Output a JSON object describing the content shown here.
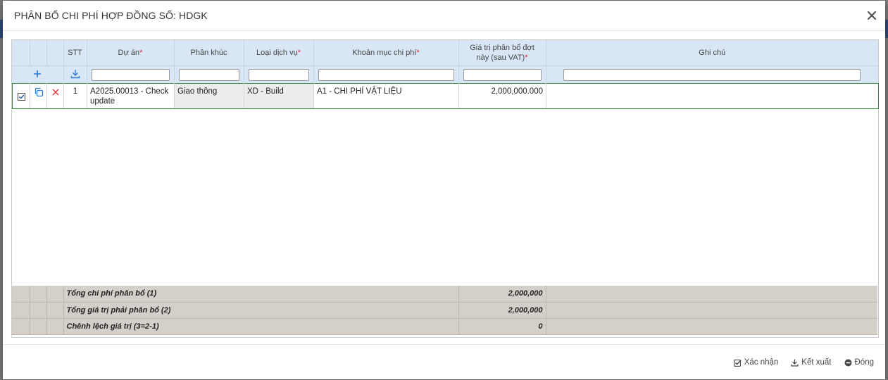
{
  "dialog": {
    "title": "PHÂN BỔ CHI PHÍ HỢP ĐỒNG SỐ: HDGK"
  },
  "grid": {
    "columns": [
      {
        "key": "stt",
        "label": "STT",
        "required": ""
      },
      {
        "key": "du_an",
        "label": "Dự án",
        "required": "*"
      },
      {
        "key": "phan_khuc",
        "label": "Phân khúc",
        "required": ""
      },
      {
        "key": "loai_dich_vu",
        "label": "Loại dịch vụ",
        "required": "*"
      },
      {
        "key": "khoan_muc",
        "label": "Khoản mục chi phí",
        "required": "*"
      },
      {
        "key": "gia_tri",
        "label": "Giá trị phân bổ đợt này (sau VAT)",
        "required": "*"
      },
      {
        "key": "ghi_chu",
        "label": "Ghi chú",
        "required": ""
      }
    ],
    "rows": [
      {
        "stt": "1",
        "du_an": "A2025.00013 - Check update",
        "phan_khuc": "Giao thông",
        "loai_dich_vu": "XD - Build",
        "khoan_muc": "A1 - CHI PHÍ VẬT LIỆU",
        "gia_tri": "2,000,000.000",
        "ghi_chu": ""
      }
    ],
    "summary": [
      {
        "label": "Tổng chi phí phân bổ (1)",
        "value": "2,000,000"
      },
      {
        "label": "Tổng giá trị phải phân bổ (2)",
        "value": "2,000,000"
      },
      {
        "label": "Chênh lệch giá trị (3=2-1)",
        "value": "0"
      }
    ]
  },
  "footer": {
    "confirm_label": "Xác nhận",
    "export_label": "Kết xuất",
    "close_label": "Đóng"
  },
  "colors": {
    "header_bg": "#d8e6f5",
    "summary_bg": "#d4d0c9",
    "row_border": "#2e8b3c",
    "required": "#d9262c",
    "icon_blue": "#2f7bd3",
    "delete_red": "#e03131"
  }
}
